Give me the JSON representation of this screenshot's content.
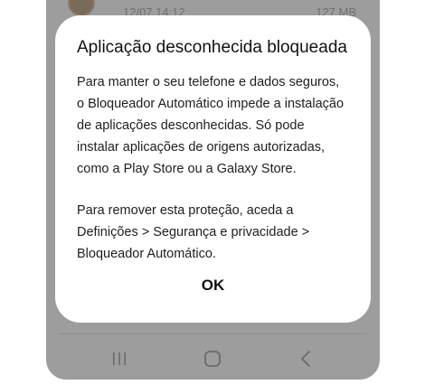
{
  "background": {
    "file_date": "12/07 14:12",
    "file_size": "127 MB"
  },
  "dialog": {
    "title": "Aplicação desconhecida bloqueada",
    "paragraph_1": "Para manter o seu telefone e dados seguros, o Bloqueador Automático impede a instalação de aplicações desconhecidas. Só pode instalar aplicações de origens autorizadas, como a Play Store ou a Galaxy Store.",
    "paragraph_2": "Para remover esta proteção, aceda a Definições > Segurança e privacidade > Bloqueador Automático.",
    "ok_label": "OK"
  },
  "navbar": {
    "recent_icon": "recent-apps-icon",
    "home_icon": "home-icon",
    "back_icon": "back-icon"
  },
  "colors": {
    "scrim": "#9d9d9d",
    "dialog_bg": "#ffffff",
    "text": "#111111"
  }
}
